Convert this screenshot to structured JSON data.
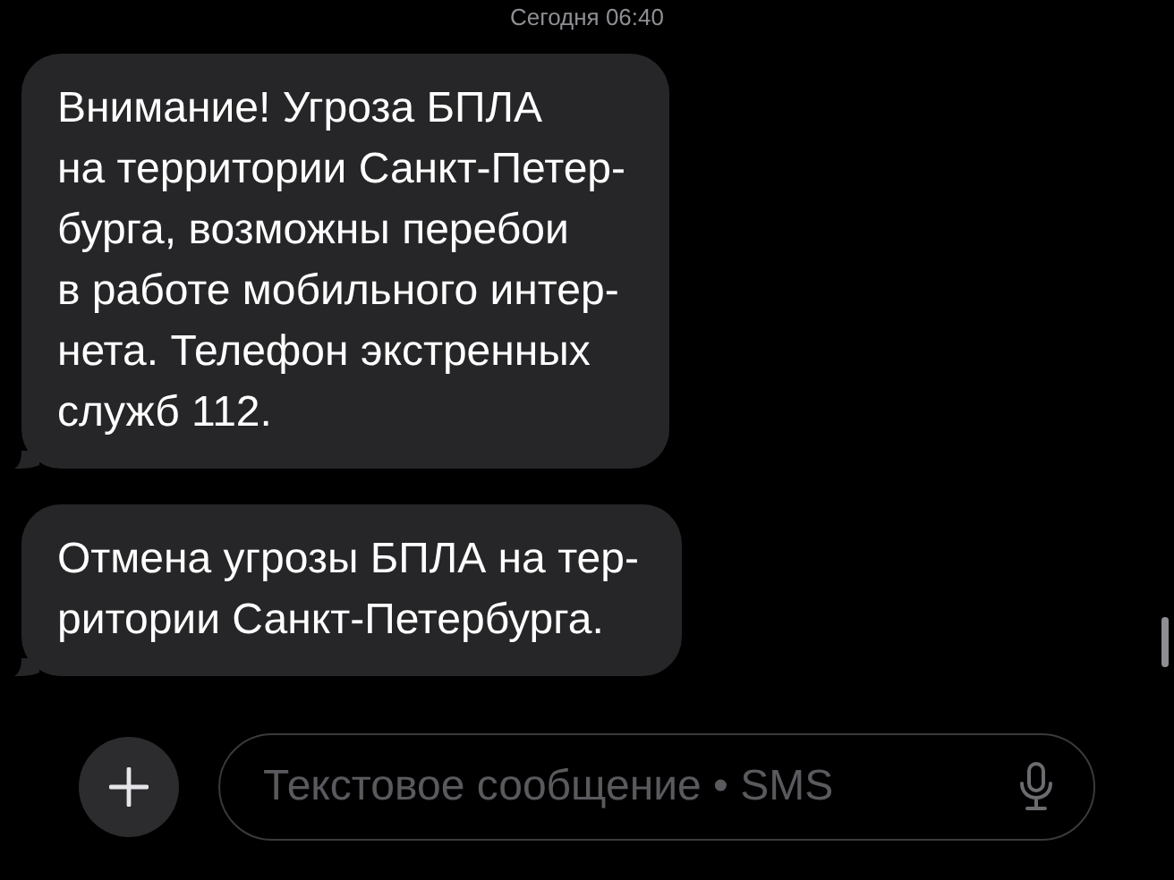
{
  "date_header": "Сегодня 06:40",
  "messages": [
    {
      "text": "Внимание! Угроза БПЛА\nна территории Санкт-Петер-\nбурга, возможны перебои\nв работе мобильного интер-\nнета. Телефон экстренных\nслужб 112."
    },
    {
      "text": "Отмена угрозы БПЛА на тер-\nритории Санкт-Петербурга."
    }
  ],
  "compose": {
    "placeholder": "Текстовое сообщение • SMS"
  }
}
